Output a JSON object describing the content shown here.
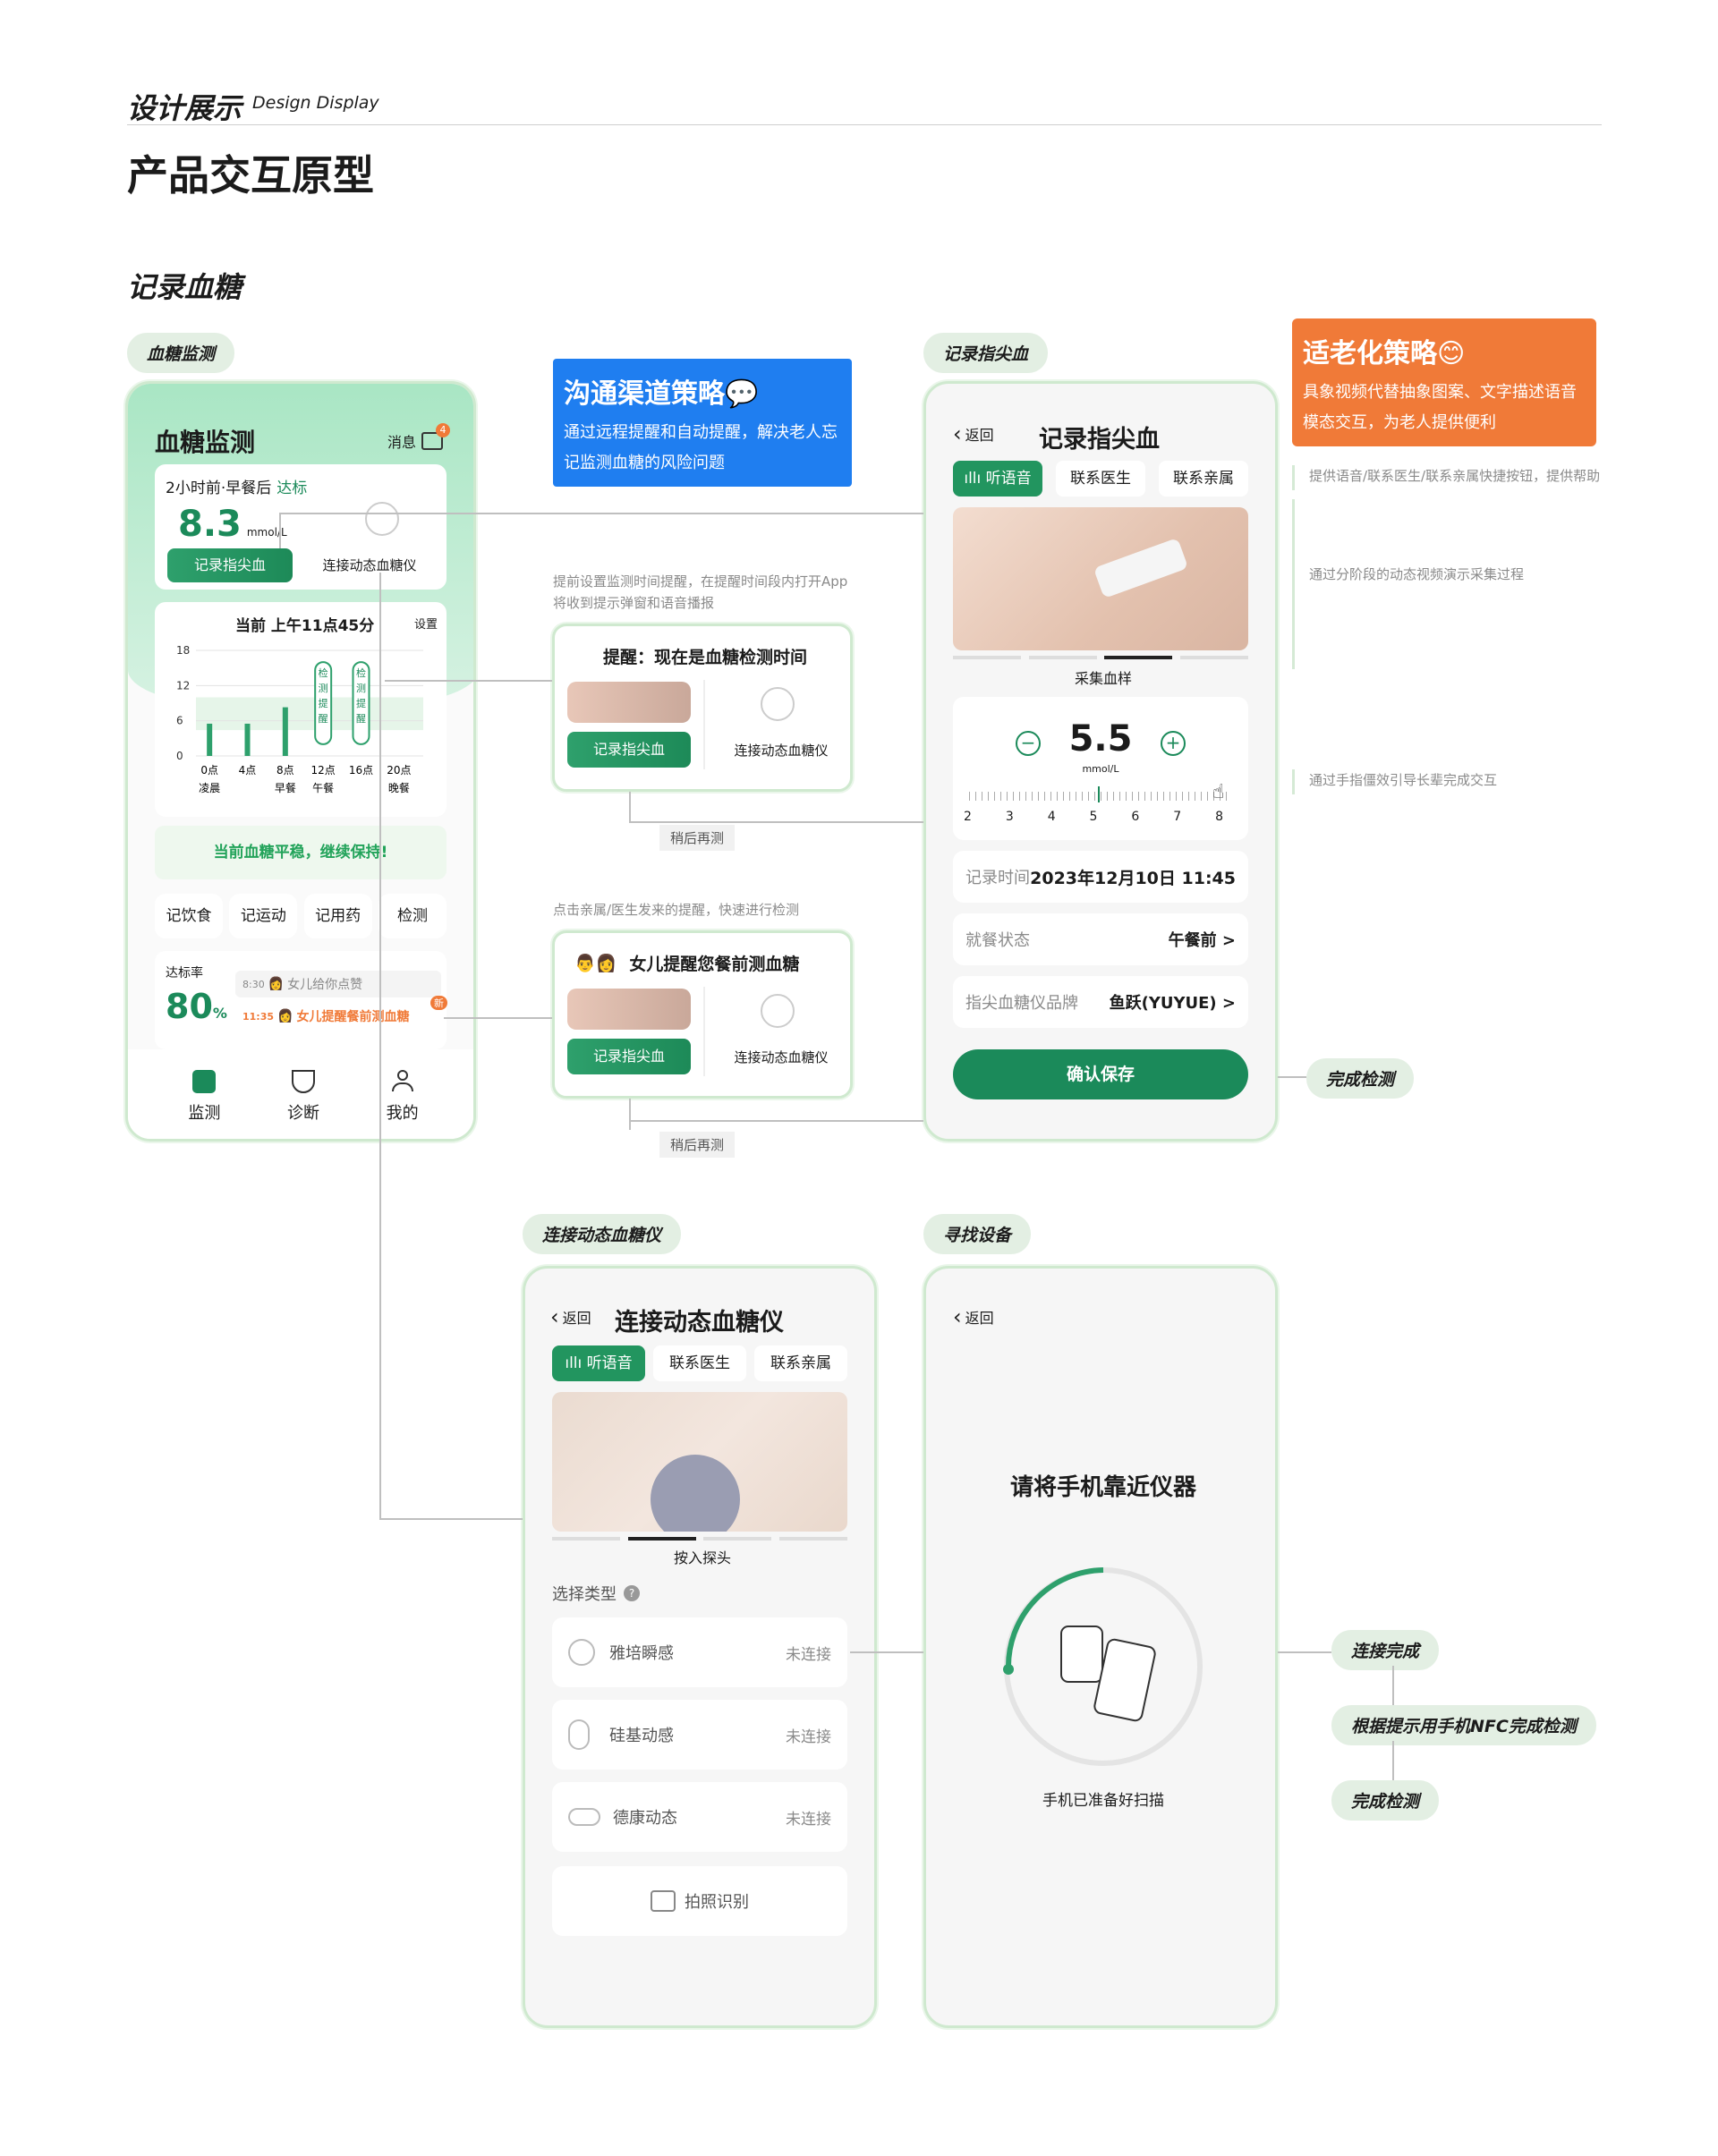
{
  "header": {
    "section_cn": "设计展示",
    "section_en": "Design Display",
    "title": "产品交互原型"
  },
  "section_title": "记录血糖",
  "labels": {
    "monitor": "血糖监测",
    "fingertip": "记录指尖血",
    "connect": "连接动态血糖仪",
    "find": "寻找设备"
  },
  "strategy_blue": {
    "title": "沟通渠道策略💬",
    "desc": "通过远程提醒和自动提醒，解决老人忘记监测血糖的风险问题"
  },
  "strategy_orange": {
    "title": "适老化策略😊",
    "desc": "具象视频代替抽象图案、文字描述语音模态交互，为老人提供便利"
  },
  "notes": {
    "n1": "提供语音/联系医生/联系亲属快捷按钮，提供帮助",
    "n2": "通过分阶段的动态视频演示采集过程",
    "n3": "通过手指僵效引导长辈完成交互",
    "remind_setup": "提前设置监测时间提醒，在提醒时间段内打开App将收到提示弹窗和语音播报",
    "remind_family": "点击亲属/医生发来的提醒，快速进行检测"
  },
  "monitor_screen": {
    "title": "血糖监测",
    "msg": "消息",
    "msg_badge": "4",
    "recent": "2小时前·早餐后",
    "recent_status": "达标",
    "value": "8.3",
    "unit": "mmol/L",
    "btn_record": "记录指尖血",
    "btn_connect": "连接动态血糖仪",
    "now": "当前 上午11点45分",
    "settings": "设置",
    "status_msg": "当前血糖平稳，继续保持!",
    "quick": [
      "记饮食",
      "记运动",
      "记用药",
      "检测"
    ],
    "rate_label": "达标率",
    "rate": "80",
    "rate_unit": "%",
    "feed1_time": "8:30",
    "feed1_text": "女儿给你点赞",
    "feed2_time": "11:35",
    "feed2_text": "女儿提醒餐前测血糖",
    "new_badge": "新",
    "nav": [
      "监测",
      "诊断",
      "我的"
    ],
    "marker_label": "检测提醒"
  },
  "chart_data": {
    "type": "bar",
    "categories": [
      "0点",
      "4点",
      "8点",
      "12点",
      "16点",
      "20点"
    ],
    "category_sublabels": [
      "凌晨",
      "",
      "早餐",
      "午餐",
      "",
      "晚餐"
    ],
    "values": [
      5.5,
      5.5,
      8.3,
      null,
      null,
      null
    ],
    "ylim": [
      0,
      18
    ],
    "yticks": [
      0,
      6,
      12,
      18
    ]
  },
  "popup1": {
    "title": "提醒：现在是血糖检测时间",
    "btn_record": "记录指尖血",
    "btn_connect": "连接动态血糖仪",
    "later": "稍后再测"
  },
  "popup2": {
    "title": "女儿提醒您餐前测血糖",
    "btn_record": "记录指尖血",
    "btn_connect": "连接动态血糖仪",
    "later": "稍后再测"
  },
  "fingertip_screen": {
    "back": "返回",
    "title": "记录指尖血",
    "tabs": [
      "听语音",
      "联系医生",
      "联系亲属"
    ],
    "caption": "采集血样",
    "value": "5.5",
    "unit": "mmol/L",
    "ruler": [
      "2",
      "3",
      "4",
      "5",
      "6",
      "7",
      "8"
    ],
    "time_label": "记录时间",
    "time_value": "2023年12月10日 11:45",
    "meal_label": "就餐状态",
    "meal_value": "午餐前 >",
    "brand_label": "指尖血糖仪品牌",
    "brand_value": "鱼跃(YUYUE) >",
    "save": "确认保存"
  },
  "done1": "完成检测",
  "connect_screen": {
    "back": "返回",
    "title": "连接动态血糖仪",
    "tabs": [
      "听语音",
      "联系医生",
      "联系亲属"
    ],
    "caption": "按入探头",
    "type_label": "选择类型",
    "devices": [
      {
        "name": "雅培瞬感",
        "status": "未连接"
      },
      {
        "name": "硅基动感",
        "status": "未连接"
      },
      {
        "name": "德康动态",
        "status": "未连接"
      }
    ],
    "photo_btn": "拍照识别"
  },
  "find_screen": {
    "back": "返回",
    "title": "请将手机靠近仪器",
    "status": "手机已准备好扫描"
  },
  "flow_end": [
    "连接完成",
    "根据提示用手机NFC完成检测",
    "完成检测"
  ],
  "colors": {
    "primary": "#1b8a5a",
    "blue": "#1f7ef0",
    "orange": "#f07a38",
    "alert": "#f07a38"
  }
}
